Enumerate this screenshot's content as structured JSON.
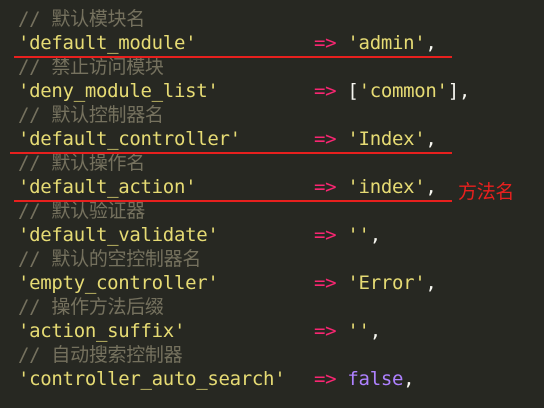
{
  "lines": [
    {
      "comment": "// 默认模块名"
    },
    {
      "key": "'default_module'",
      "arrow": "=>",
      "value": "'admin'",
      "value_type": "str",
      "trail": ","
    },
    {
      "comment": "// 禁止访问模块"
    },
    {
      "key": "'deny_module_list'",
      "arrow": "=>",
      "open": "[",
      "value": "'common'",
      "value_type": "str",
      "trail": "],"
    },
    {
      "comment": "// 默认控制器名"
    },
    {
      "key": "'default_controller'",
      "arrow": "=>",
      "value": "'Index'",
      "value_type": "str",
      "trail": ","
    },
    {
      "comment": "// 默认操作名"
    },
    {
      "key": "'default_action'",
      "arrow": "=>",
      "value": "'index'",
      "value_type": "str",
      "trail": ","
    },
    {
      "comment": "// 默认验证器"
    },
    {
      "key": "'default_validate'",
      "arrow": "=>",
      "value": "''",
      "value_type": "str",
      "trail": ","
    },
    {
      "comment": "// 默认的空控制器名"
    },
    {
      "key": "'empty_controller'",
      "arrow": "=>",
      "value": "'Error'",
      "value_type": "str",
      "trail": ","
    },
    {
      "comment": "// 操作方法后缀"
    },
    {
      "key": "'action_suffix'",
      "arrow": "=>",
      "value": "''",
      "value_type": "str",
      "trail": ","
    },
    {
      "comment": "// 自动搜索控制器"
    },
    {
      "key": "'controller_auto_search'",
      "arrow": "=>",
      "value": "false",
      "value_type": "bool",
      "trail": ","
    }
  ],
  "annotation": {
    "text": "方法名"
  },
  "colors": {
    "background": "#272822",
    "comment": "#75715E",
    "string": "#E6DB74",
    "arrow": "#F92672",
    "boolean": "#AE81FF",
    "punctuation": "#F8F8F2",
    "annotation": "#E8201E"
  }
}
